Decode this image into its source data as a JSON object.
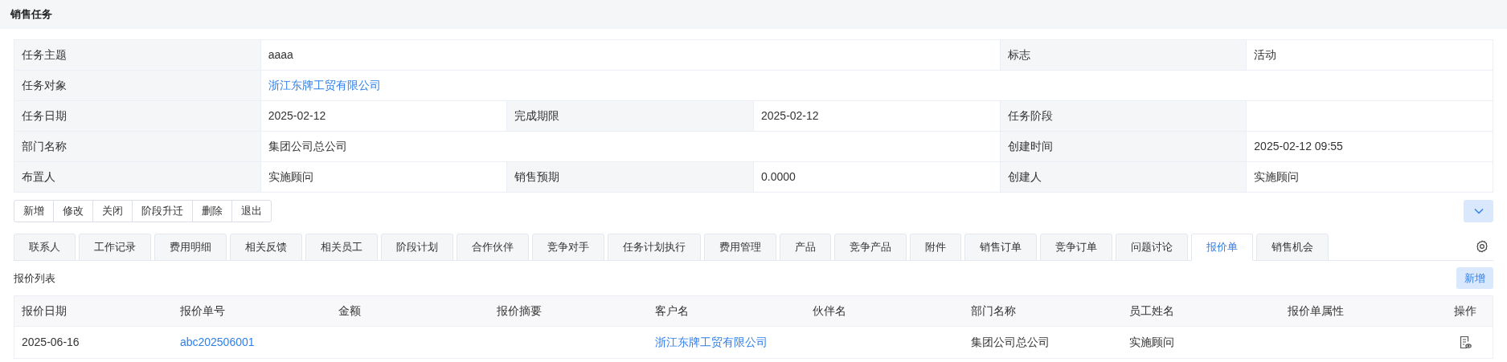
{
  "page_title": "销售任务",
  "details": [
    {
      "cells": [
        {
          "kind": "label",
          "text": "任务主题"
        },
        {
          "kind": "value",
          "text": "aaaa"
        },
        {
          "kind": "label",
          "text": "标志"
        },
        {
          "kind": "value",
          "text": "活动"
        }
      ]
    },
    {
      "cells": [
        {
          "kind": "label",
          "text": "任务对象"
        },
        {
          "kind": "link",
          "text": "浙江东牌工贸有限公司"
        }
      ]
    },
    {
      "cells": [
        {
          "kind": "label",
          "text": "任务日期"
        },
        {
          "kind": "value",
          "text": "2025-02-12"
        },
        {
          "kind": "label",
          "text": "完成期限"
        },
        {
          "kind": "value",
          "text": "2025-02-12"
        },
        {
          "kind": "label",
          "text": "任务阶段"
        },
        {
          "kind": "value"
        }
      ]
    },
    {
      "cells": [
        {
          "kind": "label",
          "text": "部门名称"
        },
        {
          "kind": "value",
          "text": "集团公司总公司"
        },
        {
          "kind": "label",
          "text": "创建时间"
        },
        {
          "kind": "value",
          "text": "2025-02-12 09:55"
        }
      ]
    },
    {
      "cells": [
        {
          "kind": "label",
          "text": "布置人"
        },
        {
          "kind": "value",
          "text": "实施顾问"
        },
        {
          "kind": "label",
          "text": "销售预期"
        },
        {
          "kind": "value",
          "text": "0.0000"
        },
        {
          "kind": "label",
          "text": "创建人"
        },
        {
          "kind": "value",
          "text": "实施顾问"
        }
      ]
    }
  ],
  "actions": [
    "新增",
    "修改",
    "关闭",
    "阶段升迁",
    "删除",
    "退出"
  ],
  "tabs": [
    {
      "label": "联系人",
      "selected": false
    },
    {
      "label": "工作记录",
      "selected": false
    },
    {
      "label": "费用明细",
      "selected": false
    },
    {
      "label": "相关反馈",
      "selected": false
    },
    {
      "label": "相关员工",
      "selected": false
    },
    {
      "label": "阶段计划",
      "selected": false
    },
    {
      "label": "合作伙伴",
      "selected": false
    },
    {
      "label": "竞争对手",
      "selected": false
    },
    {
      "label": "任务计划执行",
      "selected": false
    },
    {
      "label": "费用管理",
      "selected": false
    },
    {
      "label": "产品",
      "selected": false
    },
    {
      "label": "竞争产品",
      "selected": false
    },
    {
      "label": "附件",
      "selected": false
    },
    {
      "label": "销售订单",
      "selected": false
    },
    {
      "label": "竞争订单",
      "selected": false
    },
    {
      "label": "问题讨论",
      "selected": false
    },
    {
      "label": "报价单",
      "selected": true
    },
    {
      "label": "销售机会",
      "selected": false
    }
  ],
  "list_title": "报价列表",
  "add_button": "新增",
  "table": {
    "columns": [
      "报价日期",
      "报价单号",
      "金额",
      "报价摘要",
      "客户名",
      "伙伴名",
      "部门名称",
      "员工姓名",
      "报价单属性",
      "操作"
    ],
    "rows": [
      {
        "cells": [
          {
            "kind": "text",
            "text": "2025-06-16"
          },
          {
            "kind": "link",
            "text": "abc202506001"
          },
          {
            "kind": "empty"
          },
          {
            "kind": "empty"
          },
          {
            "kind": "link",
            "text": "浙江东牌工贸有限公司"
          },
          {
            "kind": "empty"
          },
          {
            "kind": "text",
            "text": "集团公司总公司"
          },
          {
            "kind": "text",
            "text": "实施顾问"
          },
          {
            "kind": "empty"
          },
          {
            "kind": "view"
          }
        ]
      }
    ]
  }
}
